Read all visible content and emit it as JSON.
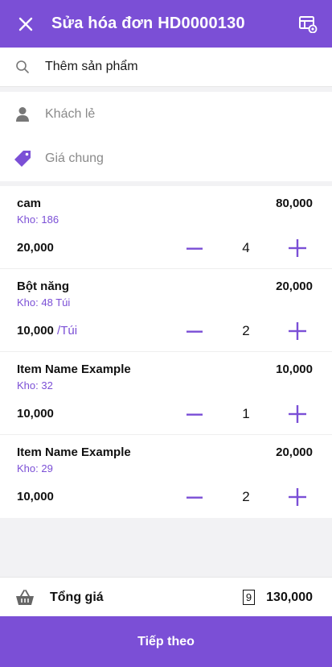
{
  "header": {
    "title": "Sửa hóa đơn HD0000130"
  },
  "search": {
    "label": "Thêm sản phẩm"
  },
  "customer": {
    "label": "Khách lẻ"
  },
  "pricebook": {
    "label": "Giá chung"
  },
  "items": [
    {
      "name": "cam",
      "total": "80,000",
      "stock": "Kho: 186",
      "price": "20,000",
      "unit": "",
      "qty": "4"
    },
    {
      "name": "Bột năng",
      "total": "20,000",
      "stock": "Kho: 48 Túi",
      "price": "10,000",
      "unit": " /Túi",
      "qty": "2"
    },
    {
      "name": "Item Name Example",
      "total": "10,000",
      "stock": "Kho: 32",
      "price": "10,000",
      "unit": "",
      "qty": "1"
    },
    {
      "name": "Item Name Example",
      "total": "20,000",
      "stock": "Kho: 29",
      "price": "10,000",
      "unit": "",
      "qty": "2"
    }
  ],
  "summary": {
    "label": "Tổng giá",
    "count": "9",
    "amount": "130,000"
  },
  "next_button": {
    "label": "Tiếp theo"
  },
  "colors": {
    "accent": "#7b4fd6"
  }
}
